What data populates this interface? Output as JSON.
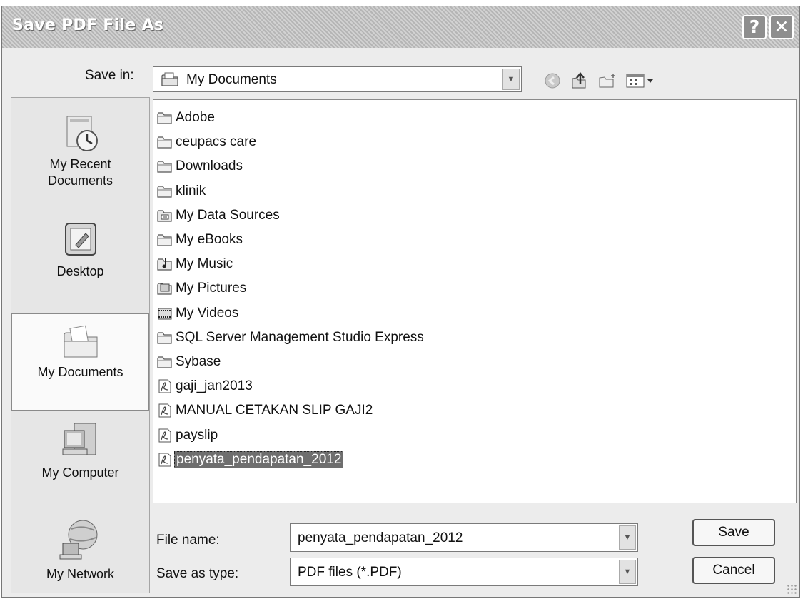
{
  "dialog": {
    "title": "Save PDF File As",
    "help_glyph": "?",
    "close_glyph": "✕"
  },
  "save_in": {
    "label": "Save in:",
    "value": "My Documents"
  },
  "places": [
    {
      "label": "My Recent Documents",
      "icon": "recent-documents-icon"
    },
    {
      "label": "Desktop",
      "icon": "desktop-icon"
    },
    {
      "label": "My Documents",
      "icon": "my-documents-icon",
      "selected": true
    },
    {
      "label": "My Computer",
      "icon": "my-computer-icon"
    },
    {
      "label": "My Network",
      "icon": "my-network-icon"
    }
  ],
  "files": [
    {
      "name": "Adobe",
      "icon": "folder-icon"
    },
    {
      "name": "ceupacs care",
      "icon": "folder-icon"
    },
    {
      "name": "Downloads",
      "icon": "folder-icon"
    },
    {
      "name": "klinik",
      "icon": "folder-icon"
    },
    {
      "name": "My Data Sources",
      "icon": "data-sources-folder-icon"
    },
    {
      "name": "My eBooks",
      "icon": "folder-icon"
    },
    {
      "name": "My Music",
      "icon": "music-folder-icon"
    },
    {
      "name": "My Pictures",
      "icon": "pictures-folder-icon"
    },
    {
      "name": "My Videos",
      "icon": "videos-folder-icon"
    },
    {
      "name": "SQL Server Management Studio Express",
      "icon": "folder-icon"
    },
    {
      "name": "Sybase",
      "icon": "folder-icon"
    },
    {
      "name": "gaji_jan2013",
      "icon": "pdf-file-icon"
    },
    {
      "name": "MANUAL CETAKAN SLIP GAJI2",
      "icon": "pdf-file-icon"
    },
    {
      "name": "payslip",
      "icon": "pdf-file-icon"
    },
    {
      "name": "penyata_pendapatan_2012",
      "icon": "pdf-file-icon",
      "selected": true
    }
  ],
  "file_name": {
    "label": "File name:",
    "value": "penyata_pendapatan_2012"
  },
  "save_as_type": {
    "label": "Save as type:",
    "value": "PDF files (*.PDF)"
  },
  "buttons": {
    "save": "Save",
    "cancel": "Cancel"
  },
  "toolbar": [
    "back-icon",
    "up-folder-icon",
    "new-folder-icon",
    "views-menu-icon"
  ]
}
